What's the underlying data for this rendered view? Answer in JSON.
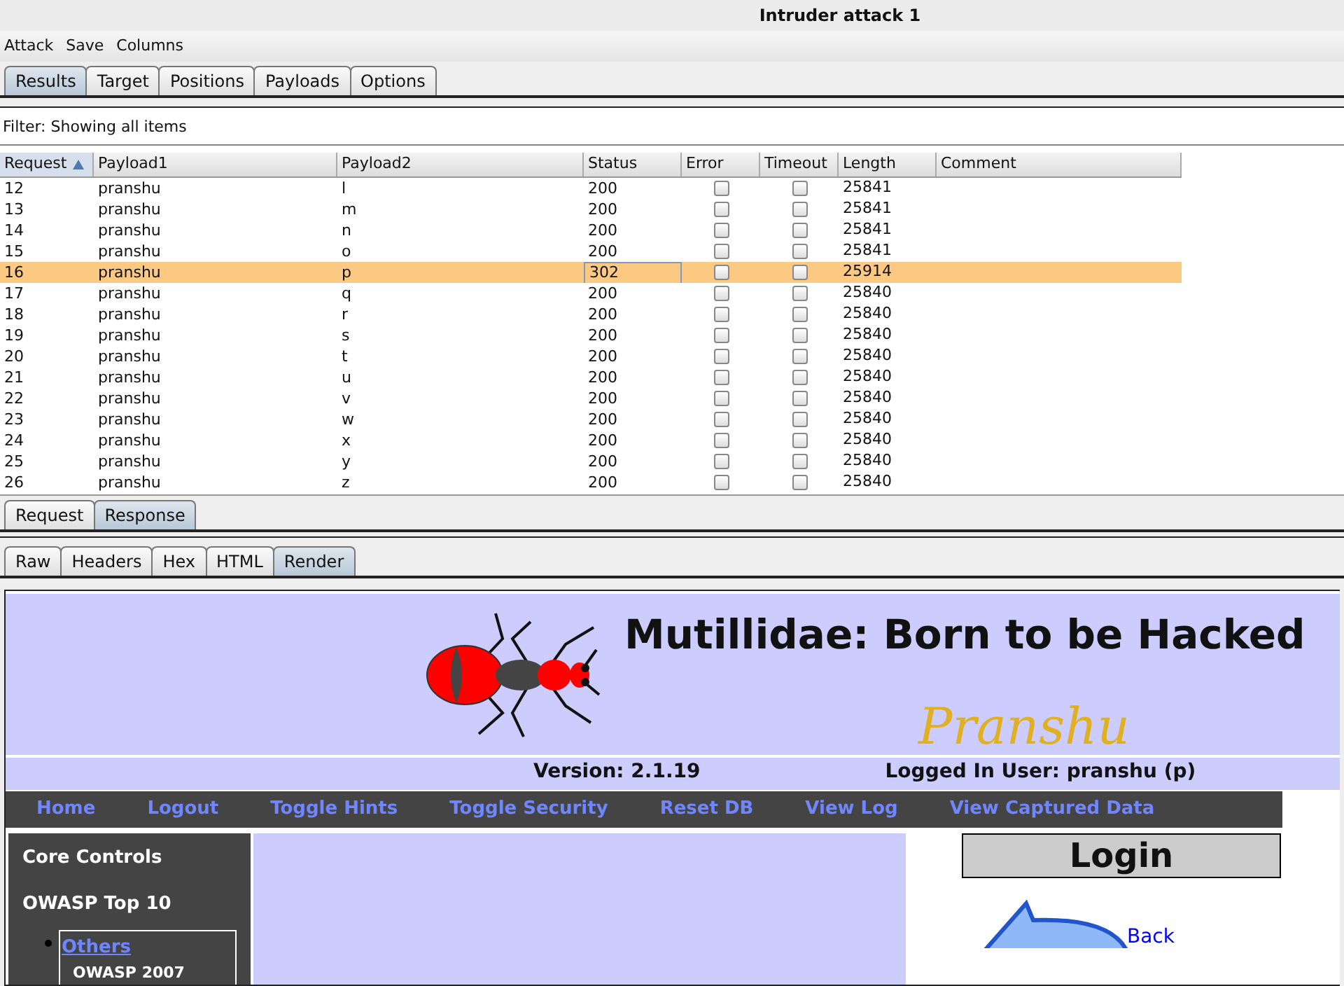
{
  "window": {
    "title": "Intruder attack 1"
  },
  "menu": [
    "Attack",
    "Save",
    "Columns"
  ],
  "tabs": [
    {
      "label": "Results",
      "selected": true
    },
    {
      "label": "Target",
      "selected": false
    },
    {
      "label": "Positions",
      "selected": false
    },
    {
      "label": "Payloads",
      "selected": false
    },
    {
      "label": "Options",
      "selected": false
    }
  ],
  "filter": "Filter: Showing all items",
  "table": {
    "columns": [
      {
        "label": "Request",
        "sorted": true
      },
      {
        "label": "Payload1",
        "sorted": false
      },
      {
        "label": "Payload2",
        "sorted": false
      },
      {
        "label": "Status",
        "sorted": false
      },
      {
        "label": "Error",
        "sorted": false
      },
      {
        "label": "Timeout",
        "sorted": false
      },
      {
        "label": "Length",
        "sorted": false
      },
      {
        "label": "Comment",
        "sorted": false
      }
    ],
    "rows": [
      {
        "cells": [
          "12",
          "pranshu",
          "l",
          "200",
          "25841"
        ],
        "error": false,
        "timeout": false,
        "selected": false
      },
      {
        "cells": [
          "13",
          "pranshu",
          "m",
          "200",
          "25841"
        ],
        "error": false,
        "timeout": false,
        "selected": false
      },
      {
        "cells": [
          "14",
          "pranshu",
          "n",
          "200",
          "25841"
        ],
        "error": false,
        "timeout": false,
        "selected": false
      },
      {
        "cells": [
          "15",
          "pranshu",
          "o",
          "200",
          "25841"
        ],
        "error": false,
        "timeout": false,
        "selected": false
      },
      {
        "cells": [
          "16",
          "pranshu",
          "p",
          "302",
          "25914"
        ],
        "error": false,
        "timeout": false,
        "selected": true
      },
      {
        "cells": [
          "17",
          "pranshu",
          "q",
          "200",
          "25840"
        ],
        "error": false,
        "timeout": false,
        "selected": false
      },
      {
        "cells": [
          "18",
          "pranshu",
          "r",
          "200",
          "25840"
        ],
        "error": false,
        "timeout": false,
        "selected": false
      },
      {
        "cells": [
          "19",
          "pranshu",
          "s",
          "200",
          "25840"
        ],
        "error": false,
        "timeout": false,
        "selected": false
      },
      {
        "cells": [
          "20",
          "pranshu",
          "t",
          "200",
          "25840"
        ],
        "error": false,
        "timeout": false,
        "selected": false
      },
      {
        "cells": [
          "21",
          "pranshu",
          "u",
          "200",
          "25840"
        ],
        "error": false,
        "timeout": false,
        "selected": false
      },
      {
        "cells": [
          "22",
          "pranshu",
          "v",
          "200",
          "25840"
        ],
        "error": false,
        "timeout": false,
        "selected": false
      },
      {
        "cells": [
          "23",
          "pranshu",
          "w",
          "200",
          "25840"
        ],
        "error": false,
        "timeout": false,
        "selected": false
      },
      {
        "cells": [
          "24",
          "pranshu",
          "x",
          "200",
          "25840"
        ],
        "error": false,
        "timeout": false,
        "selected": false
      },
      {
        "cells": [
          "25",
          "pranshu",
          "y",
          "200",
          "25840"
        ],
        "error": false,
        "timeout": false,
        "selected": false
      },
      {
        "cells": [
          "26",
          "pranshu",
          "z",
          "200",
          "25840"
        ],
        "error": false,
        "timeout": false,
        "selected": false
      }
    ]
  },
  "message_tabs": [
    {
      "label": "Request",
      "selected": false
    },
    {
      "label": "Response",
      "selected": true
    }
  ],
  "view_tabs": [
    {
      "label": "Raw",
      "selected": false
    },
    {
      "label": "Headers",
      "selected": false
    },
    {
      "label": "Hex",
      "selected": false
    },
    {
      "label": "HTML",
      "selected": false
    },
    {
      "label": "Render",
      "selected": true
    }
  ],
  "render": {
    "site_title": "Mutillidae: Born to be Hacked",
    "signature": "Pranshu",
    "version": "Version: 2.1.19",
    "logged_in": "Logged In User: pranshu (p)",
    "nav": [
      "Home",
      "Logout",
      "Toggle Hints",
      "Toggle Security",
      "Reset DB",
      "View Log",
      "View Captured Data"
    ],
    "sidebar": [
      "Core Controls",
      "OWASP Top 10"
    ],
    "submenu": [
      "Others",
      "OWASP 2007"
    ],
    "login_title": "Login",
    "back_link": "Back"
  }
}
